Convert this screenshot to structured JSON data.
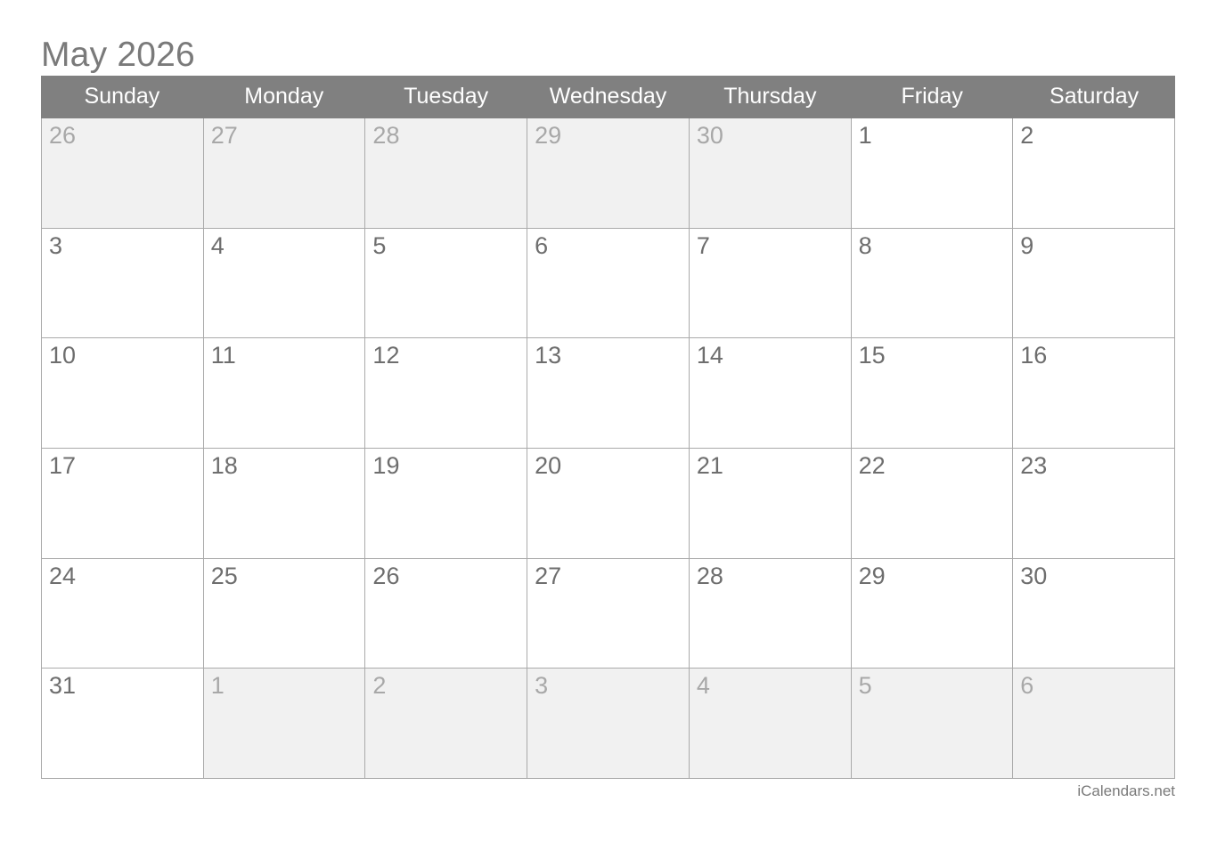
{
  "title": "May 2026",
  "weekdays": [
    "Sunday",
    "Monday",
    "Tuesday",
    "Wednesday",
    "Thursday",
    "Friday",
    "Saturday"
  ],
  "weeks": [
    [
      {
        "day": "26",
        "current": false
      },
      {
        "day": "27",
        "current": false
      },
      {
        "day": "28",
        "current": false
      },
      {
        "day": "29",
        "current": false
      },
      {
        "day": "30",
        "current": false
      },
      {
        "day": "1",
        "current": true
      },
      {
        "day": "2",
        "current": true
      }
    ],
    [
      {
        "day": "3",
        "current": true
      },
      {
        "day": "4",
        "current": true
      },
      {
        "day": "5",
        "current": true
      },
      {
        "day": "6",
        "current": true
      },
      {
        "day": "7",
        "current": true
      },
      {
        "day": "8",
        "current": true
      },
      {
        "day": "9",
        "current": true
      }
    ],
    [
      {
        "day": "10",
        "current": true
      },
      {
        "day": "11",
        "current": true
      },
      {
        "day": "12",
        "current": true
      },
      {
        "day": "13",
        "current": true
      },
      {
        "day": "14",
        "current": true
      },
      {
        "day": "15",
        "current": true
      },
      {
        "day": "16",
        "current": true
      }
    ],
    [
      {
        "day": "17",
        "current": true
      },
      {
        "day": "18",
        "current": true
      },
      {
        "day": "19",
        "current": true
      },
      {
        "day": "20",
        "current": true
      },
      {
        "day": "21",
        "current": true
      },
      {
        "day": "22",
        "current": true
      },
      {
        "day": "23",
        "current": true
      }
    ],
    [
      {
        "day": "24",
        "current": true
      },
      {
        "day": "25",
        "current": true
      },
      {
        "day": "26",
        "current": true
      },
      {
        "day": "27",
        "current": true
      },
      {
        "day": "28",
        "current": true
      },
      {
        "day": "29",
        "current": true
      },
      {
        "day": "30",
        "current": true
      }
    ],
    [
      {
        "day": "31",
        "current": true
      },
      {
        "day": "1",
        "current": false
      },
      {
        "day": "2",
        "current": false
      },
      {
        "day": "3",
        "current": false
      },
      {
        "day": "4",
        "current": false
      },
      {
        "day": "5",
        "current": false
      },
      {
        "day": "6",
        "current": false
      }
    ]
  ],
  "footer": "iCalendars.net",
  "colors": {
    "header_bg": "#808080",
    "other_month_bg": "#f1f1f1",
    "border": "#aaaaaa"
  }
}
